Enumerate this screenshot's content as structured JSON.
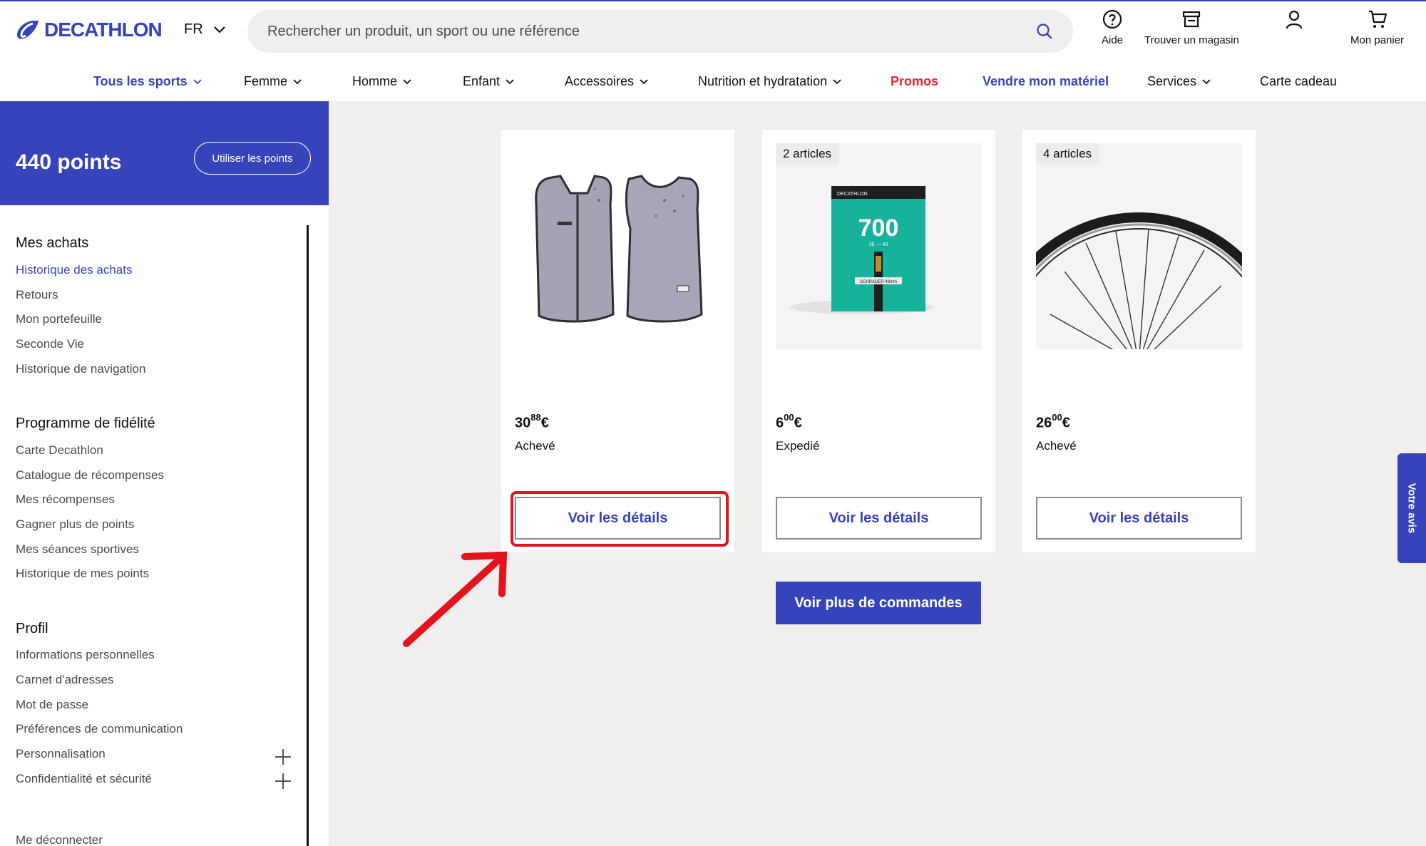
{
  "header": {
    "logo_text": "DECATHLON",
    "language": "FR",
    "search_placeholder": "Rechercher un produit, un sport ou une référence",
    "actions": [
      {
        "label": "Aide",
        "icon": "help-circle-icon"
      },
      {
        "label": "Trouver un magasin",
        "icon": "store-icon"
      },
      {
        "label": "",
        "icon": "user-icon"
      },
      {
        "label": "Mon panier",
        "icon": "cart-icon"
      }
    ]
  },
  "nav": {
    "items": [
      {
        "label": "Tous les sports",
        "dropdown": true,
        "style": "blue"
      },
      {
        "label": "Femme",
        "dropdown": true,
        "style": "normal"
      },
      {
        "label": "Homme",
        "dropdown": true,
        "style": "normal"
      },
      {
        "label": "Enfant",
        "dropdown": true,
        "style": "normal"
      },
      {
        "label": "Accessoires",
        "dropdown": true,
        "style": "normal"
      },
      {
        "label": "Nutrition et hydratation",
        "dropdown": true,
        "style": "normal"
      },
      {
        "label": "Promos",
        "dropdown": false,
        "style": "red"
      },
      {
        "label": "Vendre mon matériel",
        "dropdown": false,
        "style": "blue"
      },
      {
        "label": "Services",
        "dropdown": true,
        "style": "normal"
      },
      {
        "label": "Carte cadeau",
        "dropdown": false,
        "style": "normal"
      }
    ]
  },
  "points": {
    "value": "440 points",
    "button_label": "Utiliser les points"
  },
  "sidebar": {
    "sections": [
      {
        "title": "Mes achats",
        "items": [
          "Historique des achats",
          "Retours",
          "Mon portefeuille",
          "Seconde Vie",
          "Historique de navigation"
        ]
      },
      {
        "title": "Programme de fidélité",
        "items": [
          "Carte Decathlon",
          "Catalogue de récompenses",
          "Mes récompenses",
          "Gagner plus de points",
          "Mes séances sportives",
          "Historique de mes points"
        ]
      },
      {
        "title": "Profil",
        "items": [
          "Informations personnelles",
          "Carnet d'adresses",
          "Mot de passe",
          "Préférences de communication",
          "Personnalisation",
          "Confidentialité et sécurité"
        ]
      }
    ],
    "active_item": "Historique des achats",
    "logout_label": "Me déconnecter"
  },
  "orders": [
    {
      "badge": "",
      "price_int": "30",
      "price_dec": "88",
      "currency": "€",
      "status": "Achevé",
      "button": "Voir les détails",
      "image": "reflective-vest"
    },
    {
      "badge": "2 articles",
      "price_int": "6",
      "price_dec": "00",
      "currency": "€",
      "status": "Expedié",
      "button": "Voir les détails",
      "image": "inner-tube-box"
    },
    {
      "badge": "4 articles",
      "price_int": "26",
      "price_dec": "00",
      "currency": "€",
      "status": "Achevé",
      "button": "Voir les détails",
      "image": "bicycle-wheel"
    }
  ],
  "more_orders_label": "Voir plus de commandes",
  "feedback_label": "Votre avis",
  "product_box_text": {
    "size": "700",
    "sub": "35 — 43",
    "valve": "SCHRADER 48mm"
  },
  "colors": {
    "brand_blue": "#3643ba",
    "promo_red": "#e3262f",
    "highlight_red": "#e3141e",
    "box_teal": "#16b29a"
  }
}
